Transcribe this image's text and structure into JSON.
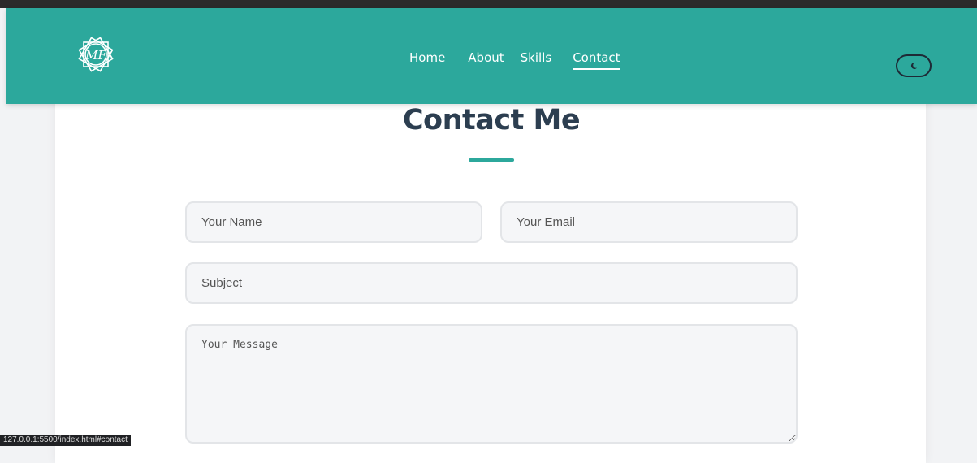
{
  "nav": {
    "logo_icon": "mf-logo-icon",
    "links": [
      {
        "label": "Home"
      },
      {
        "label": "About"
      },
      {
        "label": "Skills"
      },
      {
        "label": "Contact"
      }
    ],
    "active": "Contact",
    "theme_toggle_icon": "moon-icon"
  },
  "contact": {
    "title": "Contact Me",
    "name_placeholder": "Your Name",
    "email_placeholder": "Your Email",
    "subject_placeholder": "Subject",
    "message_placeholder": "Your Message"
  },
  "status_bar": {
    "url": "127.0.0.1:5500/index.html#contact"
  },
  "colors": {
    "accent": "#2ca89c",
    "title": "#2c3e50"
  }
}
